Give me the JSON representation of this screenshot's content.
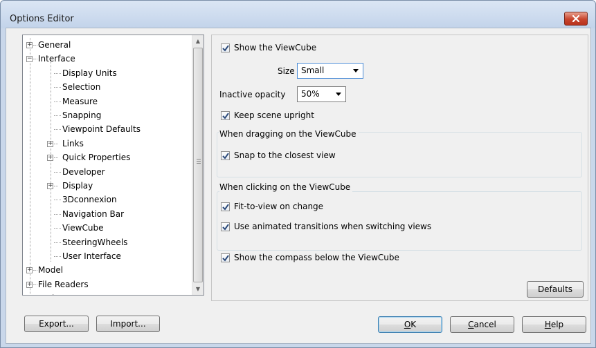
{
  "window": {
    "title": "Options Editor",
    "close_icon": "close-icon"
  },
  "tree": {
    "items": [
      {
        "label": "General",
        "level": 0,
        "expander": "+"
      },
      {
        "label": "Interface",
        "level": 0,
        "expander": "-"
      },
      {
        "label": "Display Units",
        "level": 1,
        "expander": ""
      },
      {
        "label": "Selection",
        "level": 1,
        "expander": ""
      },
      {
        "label": "Measure",
        "level": 1,
        "expander": ""
      },
      {
        "label": "Snapping",
        "level": 1,
        "expander": ""
      },
      {
        "label": "Viewpoint Defaults",
        "level": 1,
        "expander": ""
      },
      {
        "label": "Links",
        "level": 1,
        "expander": "+"
      },
      {
        "label": "Quick Properties",
        "level": 1,
        "expander": "+"
      },
      {
        "label": "Developer",
        "level": 1,
        "expander": ""
      },
      {
        "label": "Display",
        "level": 1,
        "expander": "+"
      },
      {
        "label": "3Dconnexion",
        "level": 1,
        "expander": ""
      },
      {
        "label": "Navigation Bar",
        "level": 1,
        "expander": ""
      },
      {
        "label": "ViewCube",
        "level": 1,
        "expander": ""
      },
      {
        "label": "SteeringWheels",
        "level": 1,
        "expander": ""
      },
      {
        "label": "User Interface",
        "level": 1,
        "expander": ""
      },
      {
        "label": "Model",
        "level": 0,
        "expander": "+"
      },
      {
        "label": "File Readers",
        "level": 0,
        "expander": "+"
      },
      {
        "label": "Tools",
        "level": 0,
        "expander": "+"
      }
    ]
  },
  "viewcube": {
    "show_viewcube": {
      "label": "Show the ViewCube",
      "checked": true
    },
    "size": {
      "label": "Size",
      "value": "Small"
    },
    "inactive_opacity": {
      "label": "Inactive opacity",
      "value": "50%"
    },
    "keep_upright": {
      "label": "Keep scene upright",
      "checked": true
    },
    "dragging_group": {
      "title": "When dragging on the ViewCube",
      "snap": {
        "label": "Snap to the closest view",
        "checked": true
      }
    },
    "clicking_group": {
      "title": "When clicking on the ViewCube",
      "fit": {
        "label": "Fit-to-view on change",
        "checked": true
      },
      "animated": {
        "label": "Use animated transitions when switching views",
        "checked": true
      }
    },
    "compass": {
      "label": "Show the compass below the ViewCube",
      "checked": true
    },
    "defaults_label": "Defaults"
  },
  "footer": {
    "export_label": "Export...",
    "import_label": "Import...",
    "ok_mnemonic": "O",
    "ok_rest": "K",
    "cancel_mnemonic": "C",
    "cancel_rest": "ancel",
    "help_mnemonic": "H",
    "help_rest": "elp"
  },
  "colors": {
    "title_bar": "#c9d7ea",
    "close_button": "#c8452d",
    "checkmark": "#2b4a7a"
  }
}
